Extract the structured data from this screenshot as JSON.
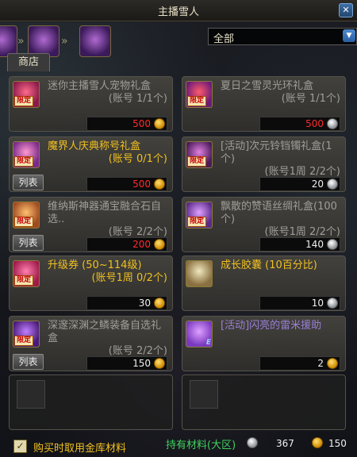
{
  "window": {
    "title": "主播雪人",
    "close_symbol": "✕"
  },
  "shop_tab": "商店",
  "filter": {
    "selected": "全部",
    "arrow": "▼"
  },
  "badges": {
    "limited": "限定",
    "list": "列表",
    "e": "E"
  },
  "items": [
    {
      "name": "迷你主播雪人宠物礼盒",
      "sub": "(账号 1/1个)",
      "price": "500",
      "currency": "gold",
      "price_color": "red",
      "name_color": "gray",
      "limited": true,
      "list_button": false
    },
    {
      "name": "夏日之雪灵光环礼盒",
      "sub": "(账号 1/1个)",
      "price": "500",
      "currency": "silver",
      "price_color": "red",
      "name_color": "gray",
      "limited": true,
      "list_button": false
    },
    {
      "name": "魔界人庆典称号礼盒",
      "sub": "(账号 0/1个)",
      "price": "500",
      "currency": "gold",
      "price_color": "red",
      "name_color": "gold",
      "limited": true,
      "list_button": true
    },
    {
      "name": "[活动]次元铃铛镯礼盒(1个)",
      "sub": "(账号1周 2/2个)",
      "price": "20",
      "currency": "silver",
      "price_color": "white",
      "name_color": "gray",
      "limited": true,
      "list_button": false
    },
    {
      "name": "维纳斯神器通宝融合石自选..",
      "sub": "(账号 2/2个)",
      "price": "200",
      "currency": "gold",
      "price_color": "red",
      "name_color": "gray",
      "limited": true,
      "list_button": true
    },
    {
      "name": "飘散的赞语丝绸礼盒(100个)",
      "sub": "(账号1周 2/2个)",
      "price": "140",
      "currency": "silver",
      "price_color": "white",
      "name_color": "gray",
      "limited": true,
      "list_button": false
    },
    {
      "name": "升级券 (50~114级)",
      "sub": "(账号1周 0/2个)",
      "price": "30",
      "currency": "gold",
      "price_color": "white",
      "name_color": "gold",
      "limited": true,
      "list_button": false
    },
    {
      "name": "成长胶囊 (10百分比)",
      "sub": "",
      "price": "10",
      "currency": "silver",
      "price_color": "white",
      "name_color": "gold",
      "limited": false,
      "list_button": false
    },
    {
      "name": "深邃深渊之鳞装备自选礼盒",
      "sub": "(账号 2/2个)",
      "price": "150",
      "currency": "gold",
      "price_color": "white",
      "name_color": "gray",
      "limited": true,
      "list_button": true
    },
    {
      "name": "[活动]闪亮的雷米援助",
      "sub": "",
      "price": "2",
      "currency": "gold",
      "price_color": "white",
      "name_color": "violet",
      "limited": false,
      "list_button": false,
      "e_badge": true
    }
  ],
  "bottom": {
    "checkbox_label": "购买时取用金库材料",
    "holdings_label": "持有材料(大区)",
    "silver_amount": "367",
    "gold_amount": "150"
  },
  "colors": {
    "gold_text": "#f0c020",
    "price_red": "#ff2a2a",
    "green_text": "#40d060"
  }
}
